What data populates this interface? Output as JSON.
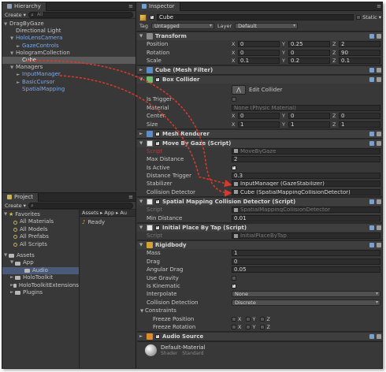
{
  "hierarchy": {
    "tab": "Hierarchy",
    "create": "Create",
    "search_placeholder": "All",
    "items": [
      {
        "label": "DragByGaze",
        "arrow": "▼",
        "class": ""
      },
      {
        "label": "Directional Light",
        "arrow": "",
        "class": ""
      },
      {
        "label": "HoloLensCamera",
        "arrow": "▼",
        "class": "blue"
      },
      {
        "label": "GazeControls",
        "arrow": "►",
        "class": "blue"
      },
      {
        "label": "HologramCollection",
        "arrow": "▼",
        "class": ""
      },
      {
        "label": "Cube",
        "arrow": "",
        "class": "selected"
      },
      {
        "label": "Managers",
        "arrow": "▼",
        "class": ""
      },
      {
        "label": "InputManager",
        "arrow": "►",
        "class": "blue"
      },
      {
        "label": "BasicCursor",
        "arrow": "►",
        "class": "blue"
      },
      {
        "label": "SpatialMapping",
        "arrow": "",
        "class": "blue"
      }
    ]
  },
  "project": {
    "tab": "Project",
    "create": "Create",
    "favorites_label": "Favorites",
    "favorites": [
      "All Materials",
      "All Models",
      "All Prefabs",
      "All Scripts"
    ],
    "assets_label": "Assets",
    "folders": [
      {
        "label": "App",
        "arrow": "▼"
      },
      {
        "label": "Audio",
        "arrow": ""
      },
      {
        "label": "HoloToolkit",
        "arrow": "►"
      },
      {
        "label": "HoloToolkitExtensions",
        "arrow": "►"
      },
      {
        "label": "Plugins",
        "arrow": "►"
      }
    ],
    "breadcrumb": [
      "Assets",
      "App",
      "Au"
    ],
    "asset_items": [
      "Ready"
    ]
  },
  "inspector": {
    "tab": "Inspector",
    "object_name": "Cube",
    "static_label": "Static",
    "tag_label": "Tag",
    "tag_value": "Untagged",
    "layer_label": "Layer",
    "layer_value": "Default",
    "transform": {
      "title": "Transform",
      "position_label": "Position",
      "rotation_label": "Rotation",
      "scale_label": "Scale",
      "position": [
        "0",
        "0.25",
        "2"
      ],
      "rotation": [
        "0",
        "0",
        "90"
      ],
      "scale": [
        "0.1",
        "0.2",
        "0.1"
      ]
    },
    "mesh_filter": {
      "title": "Cube (Mesh Filter)"
    },
    "box_collider": {
      "title": "Box Collider",
      "edit_label": "Edit Collider",
      "is_trigger_label": "Is Trigger",
      "material_label": "Material",
      "material_value": "None (Physic Material)",
      "center_label": "Center",
      "center": [
        "0",
        "0",
        "0"
      ],
      "size_label": "Size",
      "size": [
        "1",
        "1",
        "1"
      ]
    },
    "mesh_renderer": {
      "title": "Mesh Renderer"
    },
    "move_by_gaze": {
      "title": "Move By Gaze (Script)",
      "script_label": "Script",
      "script_value": "MoveByGaze",
      "max_distance_label": "Max Distance",
      "max_distance": "2",
      "is_active_label": "Is Active",
      "distance_trigger_label": "Distance Trigger",
      "distance_trigger": "0.3",
      "stabilizer_label": "Stabilizer",
      "stabilizer_value": "InputManager (GazeStabilizer)",
      "collision_detector_label": "Collision Detector",
      "collision_detector_value": "Cube (SpatialMappingCollisionDetector)"
    },
    "spatial_detector": {
      "title": "Spatial Mapping Collision Detector (Script)",
      "script_label": "Script",
      "script_value": "SpatialMappingCollisionDetector",
      "min_distance_label": "Min Distance",
      "min_distance": "0.01"
    },
    "initial_place": {
      "title": "Initial Place By Tap (Script)",
      "script_label": "Script",
      "script_value": "InitialPlaceByTap"
    },
    "rigidbody": {
      "title": "Rigidbody",
      "mass_label": "Mass",
      "mass": "1",
      "drag_label": "Drag",
      "drag": "0",
      "angular_drag_label": "Angular Drag",
      "angular_drag": "0.05",
      "use_gravity_label": "Use Gravity",
      "is_kinematic_label": "Is Kinematic",
      "interpolate_label": "Interpolate",
      "interpolate_value": "None",
      "collision_detection_label": "Collision Detection",
      "collision_detection_value": "Discrete",
      "constraints_label": "Constraints",
      "freeze_position_label": "Freeze Position",
      "freeze_rotation_label": "Freeze Rotation",
      "axes": [
        "X",
        "Y",
        "Z"
      ]
    },
    "audio_source": {
      "title": "Audio Source"
    },
    "material": {
      "name": "Default-Material",
      "shader_label": "Shader",
      "shader_value": "Standard"
    }
  },
  "colors": {
    "arrow": "#d8392b",
    "accent_blue": "#7fa8e8",
    "script_red": "#b73c3c"
  }
}
